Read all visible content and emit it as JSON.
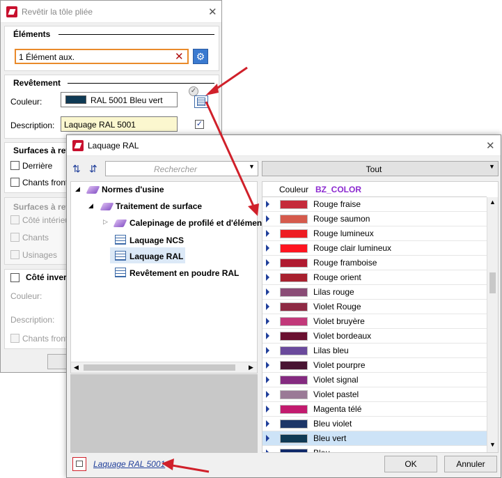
{
  "win1": {
    "title": "Revêtir la tôle pliée",
    "elements": {
      "heading": "Éléments",
      "value": "1 Élément aux."
    },
    "coating": {
      "heading": "Revêtement",
      "color_label": "Couleur:",
      "color_value": "RAL 5001 Bleu vert",
      "color_swatch": "#0f3a55",
      "desc_label": "Description:",
      "desc_value": "Laquage RAL 5001"
    },
    "surfaces": {
      "heading": "Surfaces à rev",
      "items": [
        "Derrière",
        "Chants front"
      ]
    },
    "surfaces2": {
      "heading": "Surfaces à rev",
      "items": [
        "Côté intérieu",
        "Chants",
        "Usinages"
      ]
    },
    "inverse": {
      "heading": "Côté inver",
      "color_label": "Couleur:",
      "desc_label": "Description:",
      "chk": "Chants front"
    }
  },
  "win2": {
    "title": "Laquage RAL",
    "search_placeholder": "Rechercher",
    "filter_value": "Tout",
    "tree": [
      {
        "label": "Normes d'usine"
      },
      {
        "label": "Traitement de surface"
      },
      {
        "label": "Calepinage de profilé et d'élémen"
      },
      {
        "label": "Laquage NCS"
      },
      {
        "label": "Laquage RAL"
      },
      {
        "label": "Revêtement en poudre RAL"
      }
    ],
    "columns": [
      "Couleur",
      "BZ_COLOR"
    ],
    "rows": [
      {
        "name": "Rouge fraise",
        "color": "#c52a3a"
      },
      {
        "name": "Rouge saumon",
        "color": "#d55a4c"
      },
      {
        "name": "Rouge lumineux",
        "color": "#ee1d23"
      },
      {
        "name": "Rouge clair lumineux",
        "color": "#ff1420"
      },
      {
        "name": "Rouge framboise",
        "color": "#b01a30"
      },
      {
        "name": "Rouge orient",
        "color": "#a8202e"
      },
      {
        "name": "Lilas rouge",
        "color": "#8a4c76"
      },
      {
        "name": "Violet Rouge",
        "color": "#8e2a44"
      },
      {
        "name": "Violet bruyère",
        "color": "#c2397a"
      },
      {
        "name": "Violet bordeaux",
        "color": "#6a1030"
      },
      {
        "name": "Lilas bleu",
        "color": "#6a4a9c"
      },
      {
        "name": "Violet pourpre",
        "color": "#481432"
      },
      {
        "name": "Violet signal",
        "color": "#842a80"
      },
      {
        "name": "Violet pastel",
        "color": "#9a7a96"
      },
      {
        "name": "Magenta télé",
        "color": "#c21a6e"
      },
      {
        "name": "Bleu violet",
        "color": "#1c3668"
      },
      {
        "name": "Bleu vert",
        "color": "#0f3a55"
      },
      {
        "name": "Bleu...",
        "color": "#102a6a"
      }
    ],
    "footer_link": "Laquage RAL 5001",
    "ok": "OK",
    "cancel": "Annuler"
  }
}
